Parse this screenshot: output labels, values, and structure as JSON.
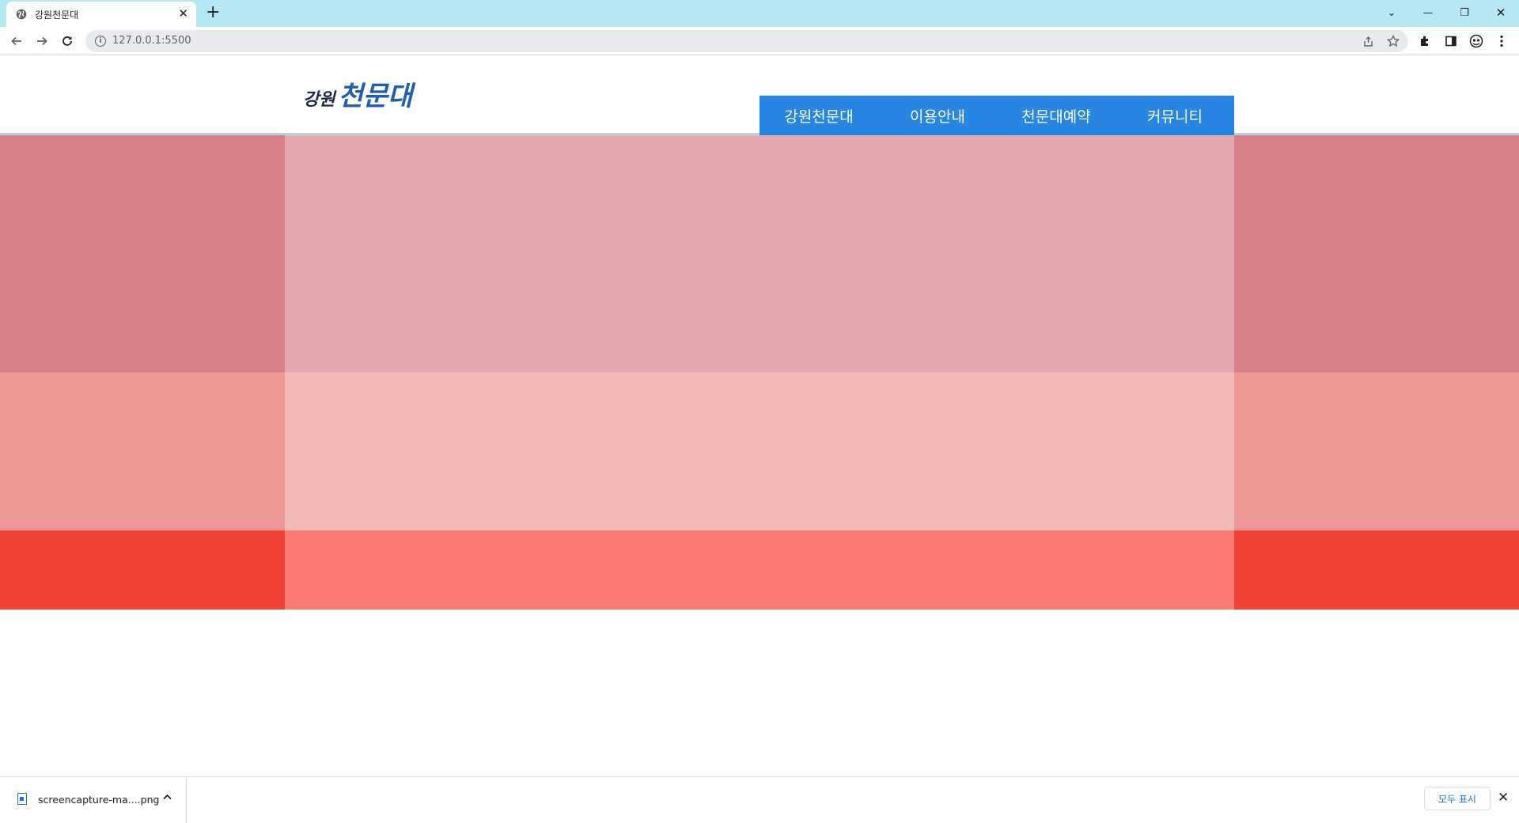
{
  "browser": {
    "tab_title": "강원천문대",
    "tab_close": "✕",
    "new_tab": "+",
    "url": "127.0.0.1:5500",
    "window_controls": {
      "list": "⌄",
      "minimize": "—",
      "restore": "❐",
      "close": "✕"
    }
  },
  "header": {
    "logo_small": "강원",
    "logo_large": "천문대",
    "nav": [
      "강원천문대",
      "이용안내",
      "천문대예약",
      "커뮤니티"
    ]
  },
  "visual": {
    "bands": [
      {
        "side_color": "#d68087",
        "center_color": "#e3a8ad"
      },
      {
        "side_color": "#ec9698",
        "center_color": "#f3b7b6"
      },
      {
        "side_color": "#f44336",
        "center_color": "#f77b72"
      }
    ]
  },
  "colors": {
    "nav_bg": "#2686e0",
    "header_border": "#2e8be0",
    "tabbar_bg": "#b6e8f2"
  },
  "downloads": {
    "file_name": "screencapture-ma....png",
    "show_all": "모두 표시",
    "close": "✕"
  }
}
